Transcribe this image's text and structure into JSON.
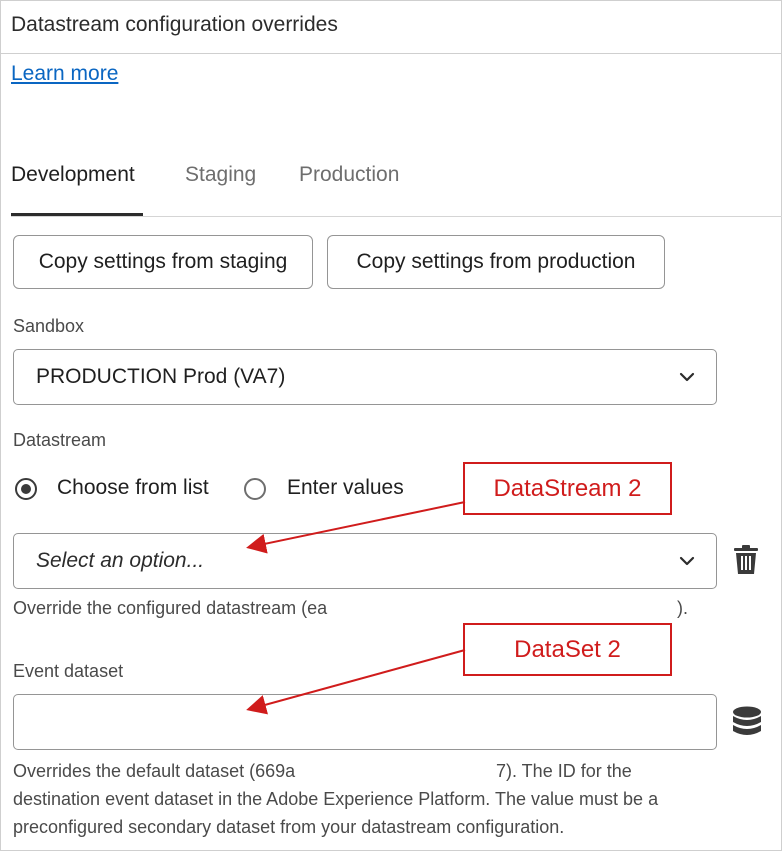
{
  "panel": {
    "title": "Datastream configuration overrides",
    "learn_more": "Learn more"
  },
  "tabs": [
    {
      "label": "Development",
      "active": true
    },
    {
      "label": "Staging",
      "active": false
    },
    {
      "label": "Production",
      "active": false
    }
  ],
  "buttons": {
    "copy_staging": "Copy settings from staging",
    "copy_production": "Copy settings from production"
  },
  "sandbox": {
    "label": "Sandbox",
    "value": "PRODUCTION Prod (VA7)"
  },
  "datastream": {
    "label": "Datastream",
    "radio_options": [
      {
        "label": "Choose from list",
        "selected": true
      },
      {
        "label": "Enter values",
        "selected": false
      }
    ],
    "select_placeholder": "Select an option...",
    "help_start": "Override the configured datastream (ea",
    "help_end": ")."
  },
  "event_dataset": {
    "label": "Event dataset",
    "value": "",
    "help_line1_start": "Overrides the default dataset (669a",
    "help_line1_end": "7). The ID for the",
    "help_line2": "destination event dataset in the Adobe Experience Platform. The value must be a",
    "help_line3": "preconfigured secondary dataset from your datastream configuration."
  },
  "annotations": {
    "callout_1": "DataStream 2",
    "callout_2": "DataSet 2",
    "color": "#d01c1c"
  },
  "icons": {
    "chevron": "chevron-down-icon",
    "trash": "trash-icon",
    "database": "database-icon"
  }
}
